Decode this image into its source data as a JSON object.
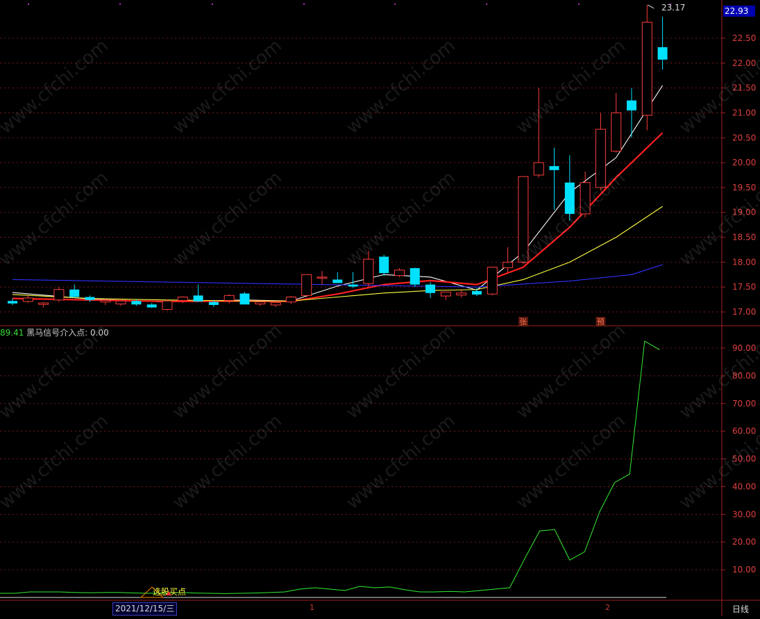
{
  "chart_data": [
    {
      "type": "candlestick",
      "price_scale": [
        "17.00",
        "17.50",
        "18.00",
        "18.50",
        "19.00",
        "19.50",
        "20.00",
        "20.50",
        "21.00",
        "21.50",
        "22.00",
        "22.50"
      ],
      "ylim": [
        16.9,
        23.25
      ],
      "current_price": "22.93",
      "high_label": "23.17",
      "candles": [
        [
          17.22,
          17.27,
          17.14,
          17.17
        ],
        [
          17.21,
          17.33,
          17.18,
          17.28
        ],
        [
          17.15,
          17.2,
          17.09,
          17.18
        ],
        [
          17.24,
          17.5,
          17.2,
          17.45
        ],
        [
          17.45,
          17.55,
          17.28,
          17.3
        ],
        [
          17.3,
          17.33,
          17.2,
          17.24
        ],
        [
          17.2,
          17.26,
          17.14,
          17.23
        ],
        [
          17.16,
          17.23,
          17.12,
          17.22
        ],
        [
          17.22,
          17.25,
          17.12,
          17.15
        ],
        [
          17.15,
          17.18,
          17.08,
          17.09
        ],
        [
          17.05,
          17.24,
          17.03,
          17.22
        ],
        [
          17.23,
          17.31,
          17.18,
          17.3
        ],
        [
          17.33,
          17.55,
          17.2,
          17.21
        ],
        [
          17.2,
          17.24,
          17.1,
          17.14
        ],
        [
          17.23,
          17.36,
          17.17,
          17.33
        ],
        [
          17.37,
          17.4,
          17.15,
          17.15
        ],
        [
          17.16,
          17.22,
          17.12,
          17.2
        ],
        [
          17.14,
          17.22,
          17.1,
          17.19
        ],
        [
          17.2,
          17.32,
          17.16,
          17.3
        ],
        [
          17.33,
          17.75,
          17.3,
          17.75
        ],
        [
          17.7,
          17.82,
          17.55,
          17.7
        ],
        [
          17.65,
          17.8,
          17.58,
          17.58
        ],
        [
          17.55,
          17.8,
          17.48,
          17.51
        ],
        [
          17.57,
          18.23,
          17.5,
          18.06
        ],
        [
          18.11,
          18.15,
          17.72,
          17.78
        ],
        [
          17.73,
          17.88,
          17.7,
          17.84
        ],
        [
          17.88,
          17.89,
          17.5,
          17.55
        ],
        [
          17.55,
          17.6,
          17.28,
          17.38
        ],
        [
          17.32,
          17.4,
          17.24,
          17.4
        ],
        [
          17.34,
          17.44,
          17.29,
          17.38
        ],
        [
          17.42,
          17.48,
          17.32,
          17.35
        ],
        [
          17.36,
          17.9,
          17.33,
          17.9
        ],
        [
          17.89,
          18.3,
          17.8,
          18.0
        ],
        [
          18.0,
          18.42,
          17.96,
          19.72
        ],
        [
          19.75,
          21.5,
          19.7,
          20.0
        ],
        [
          19.93,
          20.3,
          19.05,
          19.85
        ],
        [
          19.6,
          20.15,
          18.83,
          18.97
        ],
        [
          18.97,
          19.82,
          18.9,
          19.6
        ],
        [
          19.5,
          21.0,
          19.45,
          20.67
        ],
        [
          20.23,
          21.4,
          20.2,
          21.0
        ],
        [
          21.25,
          21.5,
          20.5,
          21.05
        ],
        [
          20.95,
          23.17,
          20.65,
          22.82
        ],
        [
          22.32,
          22.93,
          21.87,
          22.07
        ]
      ],
      "ma_series": [
        {
          "name": "MA5",
          "color": "#ffffff",
          "x": [
            0,
            5,
            10,
            15,
            18,
            21,
            24,
            27,
            30,
            33,
            36,
            39,
            42
          ],
          "values": [
            17.39,
            17.26,
            17.2,
            17.24,
            17.22,
            17.52,
            17.75,
            17.7,
            17.44,
            18.2,
            19.4,
            20.1,
            21.55
          ]
        },
        {
          "name": "MA10",
          "color": "#ff2020",
          "x": [
            0,
            5,
            10,
            15,
            18,
            21,
            24,
            27,
            30,
            33,
            36,
            39,
            42
          ],
          "values": [
            17.27,
            17.24,
            17.21,
            17.22,
            17.21,
            17.36,
            17.55,
            17.63,
            17.55,
            17.9,
            18.7,
            19.7,
            20.6
          ]
        },
        {
          "name": "MA20",
          "color": "#ffff40",
          "x": [
            0,
            5,
            10,
            15,
            18,
            21,
            24,
            27,
            30,
            33,
            36,
            39,
            42
          ],
          "values": [
            17.35,
            17.27,
            17.24,
            17.22,
            17.22,
            17.3,
            17.38,
            17.43,
            17.45,
            17.65,
            18.0,
            18.5,
            19.12
          ]
        },
        {
          "name": "MA60",
          "color": "#3030ff",
          "x": [
            0,
            10,
            20,
            30,
            36,
            40,
            42
          ],
          "values": [
            17.65,
            17.6,
            17.55,
            17.5,
            17.62,
            17.75,
            17.95
          ]
        }
      ],
      "markers": [
        {
          "candle": 33,
          "text": "张"
        },
        {
          "candle": 38,
          "text": "预"
        }
      ]
    },
    {
      "type": "line",
      "title_value": "89.41",
      "title_label": "黑马信号介入点: 0.00",
      "ylim": [
        0,
        100
      ],
      "yticks": [
        "10.00",
        "20.00",
        "30.00",
        "40.00",
        "50.00",
        "60.00",
        "70.00",
        "80.00",
        "90.00"
      ],
      "values": [
        1.5,
        1.5,
        2.0,
        2.0,
        2.0,
        1.8,
        1.7,
        1.8,
        1.8,
        1.6,
        1.5,
        1.6,
        1.8,
        1.6,
        1.5,
        1.4,
        1.5,
        1.6,
        1.8,
        2.0,
        3.0,
        3.5,
        3.0,
        2.5,
        4.0,
        3.5,
        3.8,
        2.8,
        2.0,
        2.0,
        2.2,
        2.0,
        2.5,
        3.0,
        3.5,
        14.0,
        24.0,
        24.5,
        13.5,
        16.5,
        31.0,
        41.5,
        44.5,
        92.5,
        89.4
      ],
      "signal_label": "选股买点"
    }
  ],
  "x_axis": {
    "date": "2021/12/15/三",
    "ticks": [
      "1",
      "2"
    ],
    "period": "日线"
  },
  "watermark": "www.cfchi.com"
}
